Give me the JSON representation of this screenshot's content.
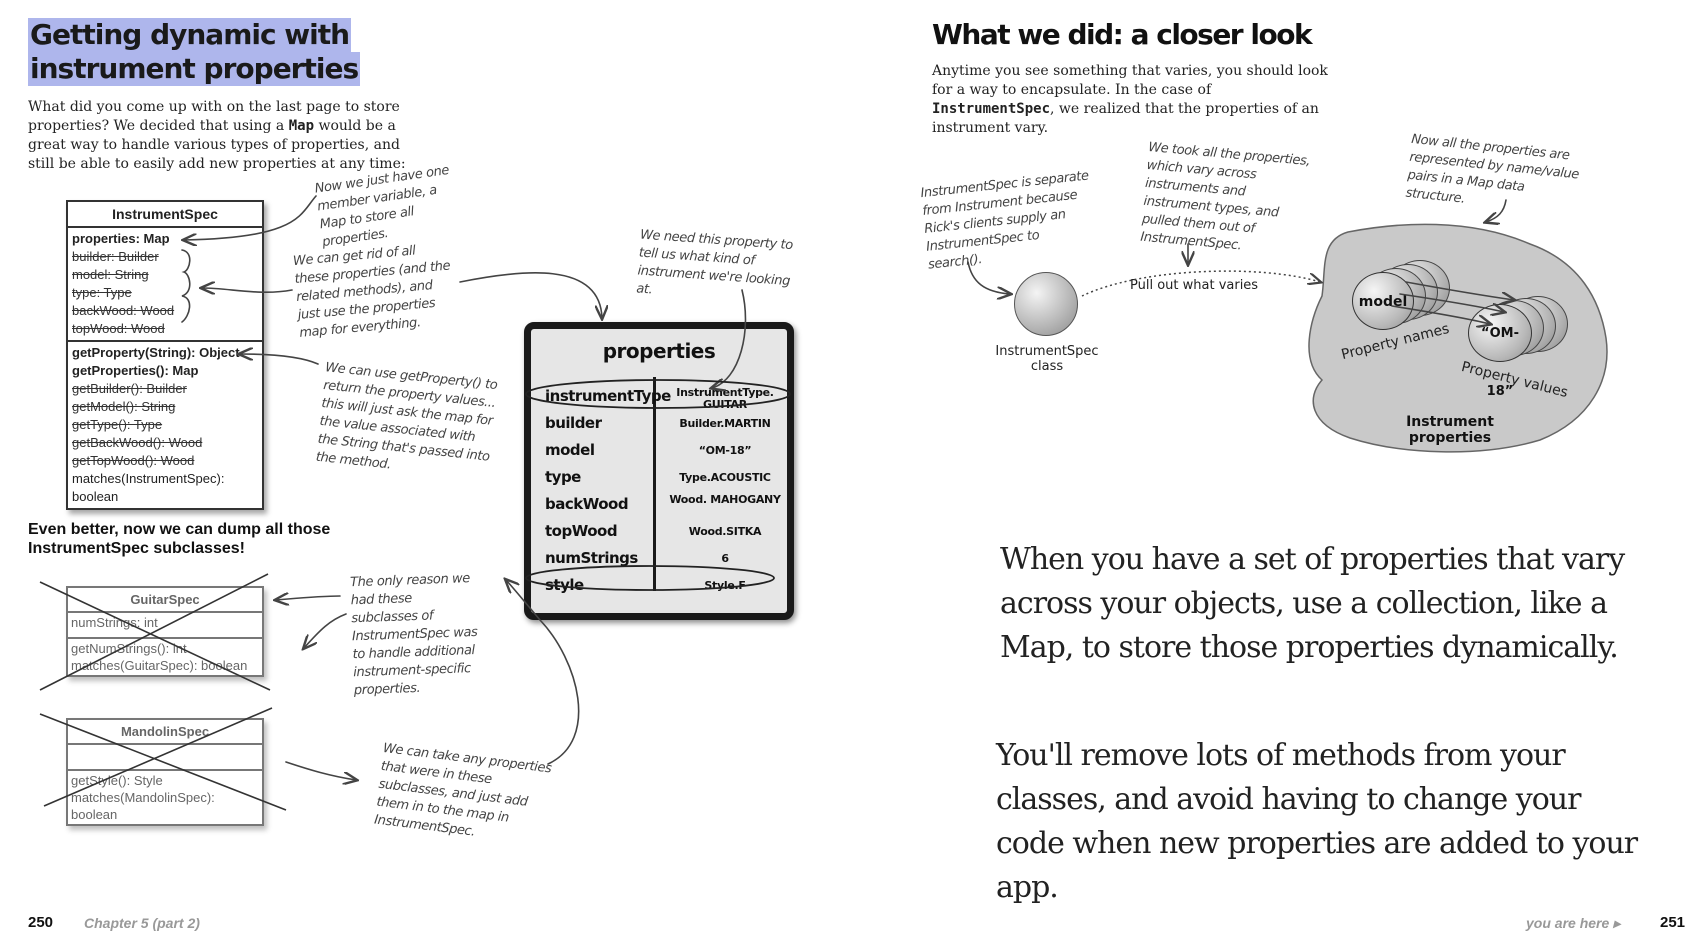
{
  "left_page": {
    "title_line1": "Getting dynamic with",
    "title_line2": "instrument properties",
    "intro_before": "What did you come up with on the last page to store properties? We decided that using a ",
    "intro_code": "Map",
    "intro_after": " would be a great way to handle various types of properties, and still be able to easily add new properties at any time:",
    "uml": {
      "name": "InstrumentSpec",
      "attributes": [
        {
          "text": "properties: Map",
          "style": "bold"
        },
        {
          "text": "builder: Builder",
          "style": "strike"
        },
        {
          "text": "model: String",
          "style": "strike"
        },
        {
          "text": "type: Type",
          "style": "strike"
        },
        {
          "text": "backWood: Wood",
          "style": "strike"
        },
        {
          "text": "topWood: Wood",
          "style": "strike"
        }
      ],
      "methods": [
        {
          "text": "getProperty(String): Object",
          "style": "bold"
        },
        {
          "text": "getProperties(): Map",
          "style": "bold"
        },
        {
          "text": "getBuilder(): Builder",
          "style": "strike"
        },
        {
          "text": "getModel(): String",
          "style": "strike"
        },
        {
          "text": "getType(): Type",
          "style": "strike"
        },
        {
          "text": "getBackWood(): Wood",
          "style": "strike"
        },
        {
          "text": "getTopWood(): Wood",
          "style": "strike"
        },
        {
          "text": "matches(InstrumentSpec): boolean",
          "style": "normal"
        }
      ]
    },
    "notes": {
      "one_member": "Now we just have one member variable, a Map to store all properties.",
      "get_rid": "We can get rid of all these properties (and the related methods), and just use the properties map for everything.",
      "get_property": "We can use getProperty() to return the property values... this will just ask the map for the value associated with the String that's passed into the method.",
      "need_property": "We need this property to tell us what kind of instrument we're looking at.",
      "only_reason": "The only reason we had these subclasses of InstrumentSpec was to handle additional instrument-specific properties.",
      "take_any": "We can take any properties that were in these subclasses, and just add them in to the map in InstrumentSpec."
    },
    "even_better_line1": "Even better, now we can dump all those",
    "even_better_line2": "InstrumentSpec subclasses!",
    "guitar_spec": {
      "name": "GuitarSpec",
      "attributes": [
        "numStrings: int"
      ],
      "methods": [
        "getNumStrings(): int",
        "matches(GuitarSpec): boolean"
      ]
    },
    "mandolin_spec": {
      "name": "MandolinSpec",
      "attributes": [],
      "methods": [
        "getStyle(): Style",
        "matches(MandolinSpec): boolean"
      ]
    },
    "properties_box": {
      "title": "properties",
      "rows": [
        {
          "key": "instrumentType",
          "value": "InstrumentType. GUITAR"
        },
        {
          "key": "builder",
          "value": "Builder.MARTIN"
        },
        {
          "key": "model",
          "value": "“OM-18”"
        },
        {
          "key": "type",
          "value": "Type.ACOUSTIC"
        },
        {
          "key": "backWood",
          "value": "Wood. MAHOGANY"
        },
        {
          "key": "topWood",
          "value": "Wood.SITKA"
        },
        {
          "key": "numStrings",
          "value": "6"
        },
        {
          "key": "style",
          "value": "Style.F"
        }
      ]
    },
    "page_number": "250",
    "chapter": "Chapter 5 (part 2)"
  },
  "right_page": {
    "title": "What we did: a closer look",
    "intro_before": "Anytime you see something that varies, you should look for a way to encapsulate. In the case of ",
    "intro_code": "InstrumentSpec",
    "intro_after": ", we realized that the properties of an instrument vary.",
    "notes": {
      "separate": "InstrumentSpec is separate from Instrument because Rick's clients supply an InstrumentSpec to search().",
      "took_all": "We took all the properties, which vary across instruments and instrument types, and pulled them out of InstrumentSpec.",
      "now_all": "Now all the properties are represented by name/value pairs in a Map data structure."
    },
    "class_label_line1": "InstrumentSpec",
    "class_label_line2": "class",
    "pull_out": "Pull out what varies",
    "blob": {
      "name_bubble": "model",
      "value_bubble": "“OM-18”",
      "names_label": "Property names",
      "values_label": "Property values",
      "caption": "Instrument properties"
    },
    "big_text_1": "When you have a set of properties that vary across your objects, use a collection, like a Map, to store those properties dynamically.",
    "big_text_2": "You'll remove lots of methods from your classes, and avoid having to change your code when new properties are added to your app.",
    "you_are_here": "you are here ▸",
    "page_number": "251"
  }
}
